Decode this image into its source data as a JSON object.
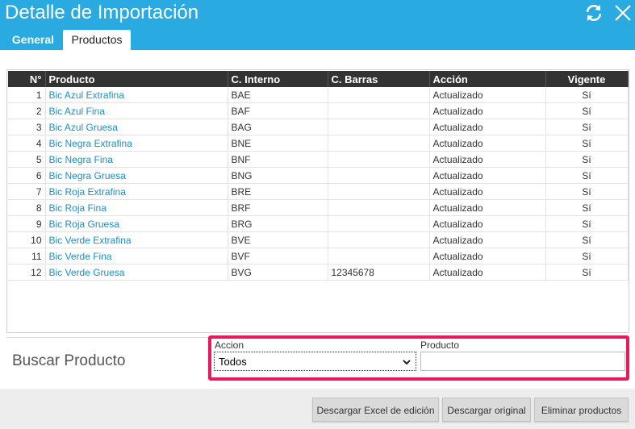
{
  "window": {
    "title": "Detalle de Importación"
  },
  "tabs": [
    {
      "label": "General"
    },
    {
      "label": "Productos"
    }
  ],
  "table": {
    "headers": [
      "N°",
      "Producto",
      "C. Interno",
      "C. Barras",
      "Acción",
      "Vigente"
    ],
    "rows": [
      [
        "1",
        "Bic Azul Extrafina",
        "BAE",
        "",
        "Actualizado",
        "Sí"
      ],
      [
        "2",
        "Bic Azul Fina",
        "BAF",
        "",
        "Actualizado",
        "Sí"
      ],
      [
        "3",
        "Bic Azul Gruesa",
        "BAG",
        "",
        "Actualizado",
        "Sí"
      ],
      [
        "4",
        "Bic Negra Extrafina",
        "BNE",
        "",
        "Actualizado",
        "Sí"
      ],
      [
        "5",
        "Bic Negra Fina",
        "BNF",
        "",
        "Actualizado",
        "Sí"
      ],
      [
        "6",
        "Bic Negra Gruesa",
        "BNG",
        "",
        "Actualizado",
        "Sí"
      ],
      [
        "7",
        "Bic Roja Extrafina",
        "BRE",
        "",
        "Actualizado",
        "Sí"
      ],
      [
        "8",
        "Bic Roja Fina",
        "BRF",
        "",
        "Actualizado",
        "Sí"
      ],
      [
        "9",
        "Bic Roja Gruesa",
        "BRG",
        "",
        "Actualizado",
        "Sí"
      ],
      [
        "10",
        "Bic Verde Extrafina",
        "BVE",
        "",
        "Actualizado",
        "Sí"
      ],
      [
        "11",
        "Bic Verde Fina",
        "BVF",
        "",
        "Actualizado",
        "Sí"
      ],
      [
        "12",
        "Bic Verde Gruesa",
        "BVG",
        "12345678",
        "Actualizado",
        "Sí"
      ]
    ]
  },
  "search": {
    "title": "Buscar Producto",
    "accion_label": "Accion",
    "accion_value": "Todos",
    "producto_label": "Producto",
    "producto_value": ""
  },
  "buttons": {
    "excel": "Descargar Excel de edición",
    "original": "Descargar original",
    "eliminar": "Eliminar productos"
  },
  "icons": {
    "refresh": "refresh-icon",
    "close": "close-icon",
    "dropdown": "chevron-down-icon"
  },
  "colors": {
    "header": "#29abe2",
    "highlight": "#e8195f",
    "link": "#1a8fc9"
  }
}
